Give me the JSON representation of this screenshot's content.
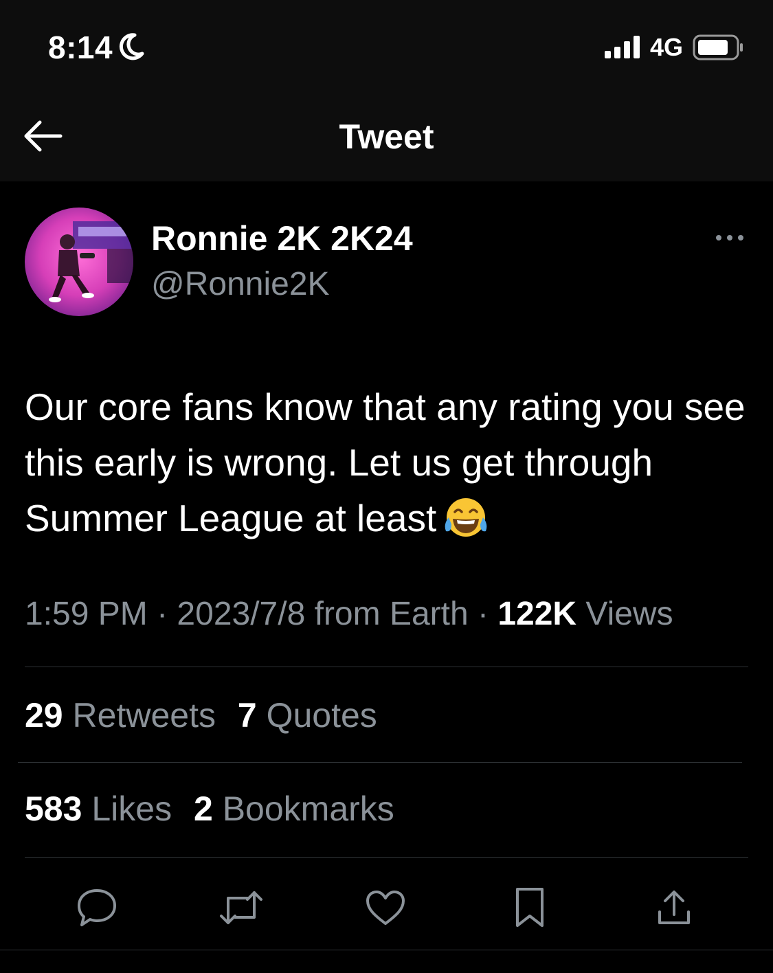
{
  "status_bar": {
    "time": "8:14",
    "network": "4G"
  },
  "nav": {
    "title": "Tweet"
  },
  "author": {
    "name": "Ronnie 2K 2K24",
    "handle": "@Ronnie2K"
  },
  "tweet": {
    "text": "Our core fans know that any rating you see this early is wrong. Let us get through Summer League at least",
    "emoji": "face-with-tears-of-joy"
  },
  "meta": {
    "time": "1:59 PM",
    "separator1": " · ",
    "date_source": "2023/7/8 from Earth",
    "separator2": " · ",
    "views_count": "122K",
    "views_label": "Views"
  },
  "stats": {
    "retweets_count": "29",
    "retweets_label": "Retweets",
    "quotes_count": "7",
    "quotes_label": "Quotes",
    "likes_count": "583",
    "likes_label": "Likes",
    "bookmarks_count": "2",
    "bookmarks_label": "Bookmarks"
  },
  "colors": {
    "background": "#000000",
    "secondary_text": "#8b9299",
    "divider": "#2f3336"
  }
}
